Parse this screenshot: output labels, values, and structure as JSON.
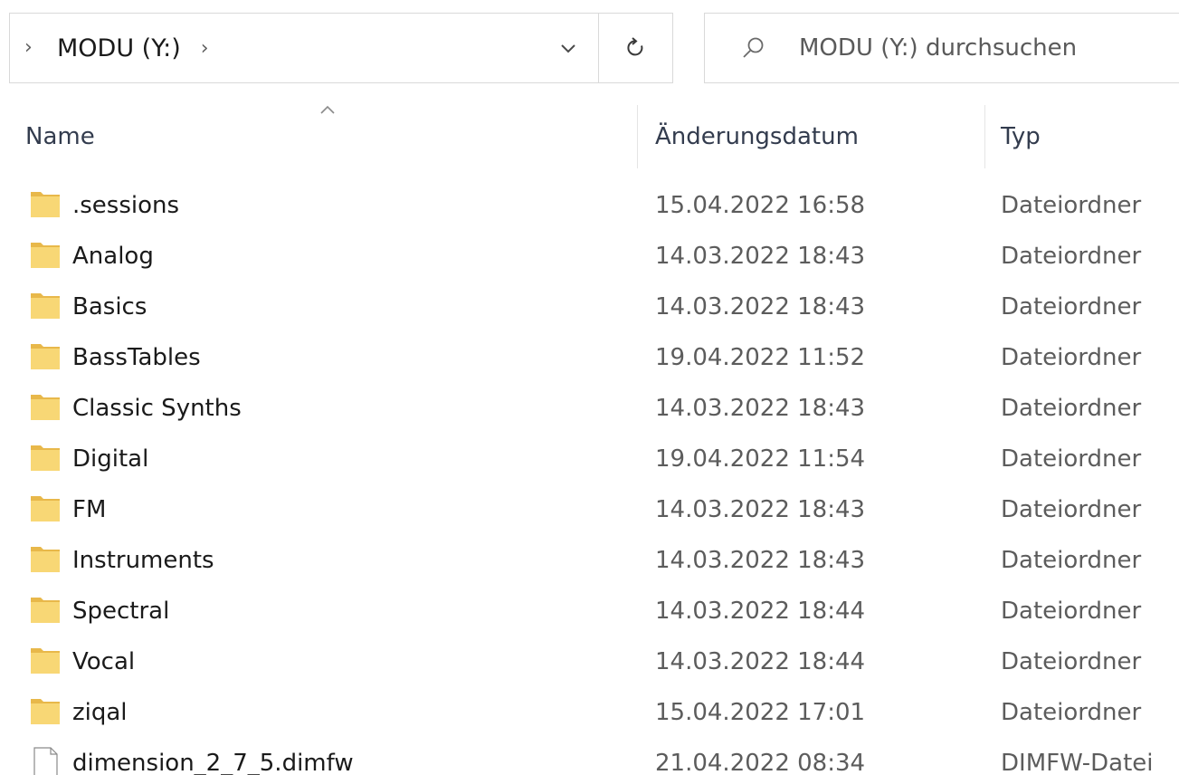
{
  "address_bar": {
    "lead_chevron": "›",
    "segment": "MODU (Y:)",
    "tail_chevron": "›"
  },
  "search": {
    "placeholder": "MODU (Y:) durchsuchen"
  },
  "columns": {
    "name": "Name",
    "date": "Änderungsdatum",
    "type": "Typ"
  },
  "files": [
    {
      "name": ".sessions",
      "date": "15.04.2022 16:58",
      "type": "Dateiordner",
      "icon": "folder-icon"
    },
    {
      "name": "Analog",
      "date": "14.03.2022 18:43",
      "type": "Dateiordner",
      "icon": "folder-icon"
    },
    {
      "name": "Basics",
      "date": "14.03.2022 18:43",
      "type": "Dateiordner",
      "icon": "folder-icon"
    },
    {
      "name": "BassTables",
      "date": "19.04.2022 11:52",
      "type": "Dateiordner",
      "icon": "folder-icon"
    },
    {
      "name": "Classic Synths",
      "date": "14.03.2022 18:43",
      "type": "Dateiordner",
      "icon": "folder-icon"
    },
    {
      "name": "Digital",
      "date": "19.04.2022 11:54",
      "type": "Dateiordner",
      "icon": "folder-icon"
    },
    {
      "name": "FM",
      "date": "14.03.2022 18:43",
      "type": "Dateiordner",
      "icon": "folder-icon"
    },
    {
      "name": "Instruments",
      "date": "14.03.2022 18:43",
      "type": "Dateiordner",
      "icon": "folder-icon"
    },
    {
      "name": "Spectral",
      "date": "14.03.2022 18:44",
      "type": "Dateiordner",
      "icon": "folder-icon"
    },
    {
      "name": "Vocal",
      "date": "14.03.2022 18:44",
      "type": "Dateiordner",
      "icon": "folder-icon"
    },
    {
      "name": "ziqal",
      "date": "15.04.2022 17:01",
      "type": "Dateiordner",
      "icon": "folder-icon"
    },
    {
      "name": "dimension_2_7_5.dimfw",
      "date": "21.04.2022 08:34",
      "type": "DIMFW-Datei",
      "icon": "file-icon"
    }
  ],
  "colors": {
    "folder_fill": "#f8d775",
    "folder_back": "#e8b84a",
    "border": "#d9d9d9",
    "header_text": "#333c4e",
    "secondary_text": "#5c5c5c"
  }
}
